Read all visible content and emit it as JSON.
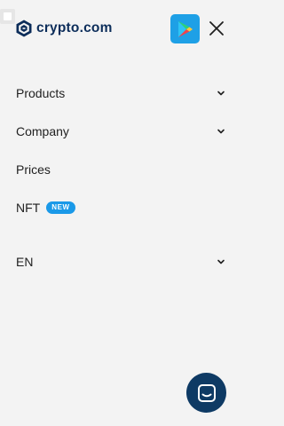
{
  "brand": {
    "name": "crypto.com",
    "color": "#0c2d5a"
  },
  "header": {
    "play_icon": "google-play-icon",
    "play_bg": "#1ea0e6",
    "close_icon": "close-icon"
  },
  "nav": {
    "items": [
      {
        "label": "Products",
        "has_dropdown": true
      },
      {
        "label": "Company",
        "has_dropdown": true
      },
      {
        "label": "Prices",
        "has_dropdown": false
      },
      {
        "label": "NFT",
        "has_dropdown": false,
        "badge": "NEW",
        "badge_color": "#1a99e8"
      },
      {
        "label": "EN",
        "has_dropdown": true
      }
    ]
  },
  "chat": {
    "icon": "chat-icon",
    "bg": "#0e3a64"
  }
}
